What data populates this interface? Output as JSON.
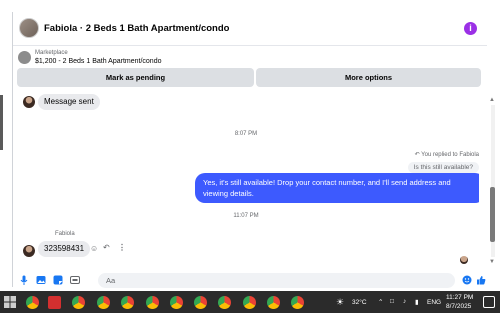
{
  "header": {
    "title": "Fabiola · 2 Beds 1 Bath Apartment/condo",
    "info_icon": "i"
  },
  "marketplace": {
    "label": "Marketplace",
    "listing": "$1,200 - 2 Beds 1 Bath Apartment/condo"
  },
  "actions": {
    "mark_pending": "Mark as pending",
    "more_options": "More options"
  },
  "messages": {
    "message_sent": "Message sent",
    "time_1": "8:07 PM",
    "replied_label": "You replied to Fabiola",
    "quoted_text": "Is this still available?",
    "outgoing_text": "Yes, it's still available! Drop your contact number, and I'll send address and viewing details.",
    "time_2": "11:07 PM",
    "sender_name": "Fabiola",
    "incoming_text": "323598431"
  },
  "composer": {
    "placeholder": "Aa"
  },
  "taskbar": {
    "weather": "32°C",
    "language": "ENG",
    "time": "11:27 PM",
    "date": "8/7/2025"
  },
  "colors": {
    "accent": "#3d5afe",
    "info": "#9b30e6",
    "icon_blue": "#1877f2"
  }
}
